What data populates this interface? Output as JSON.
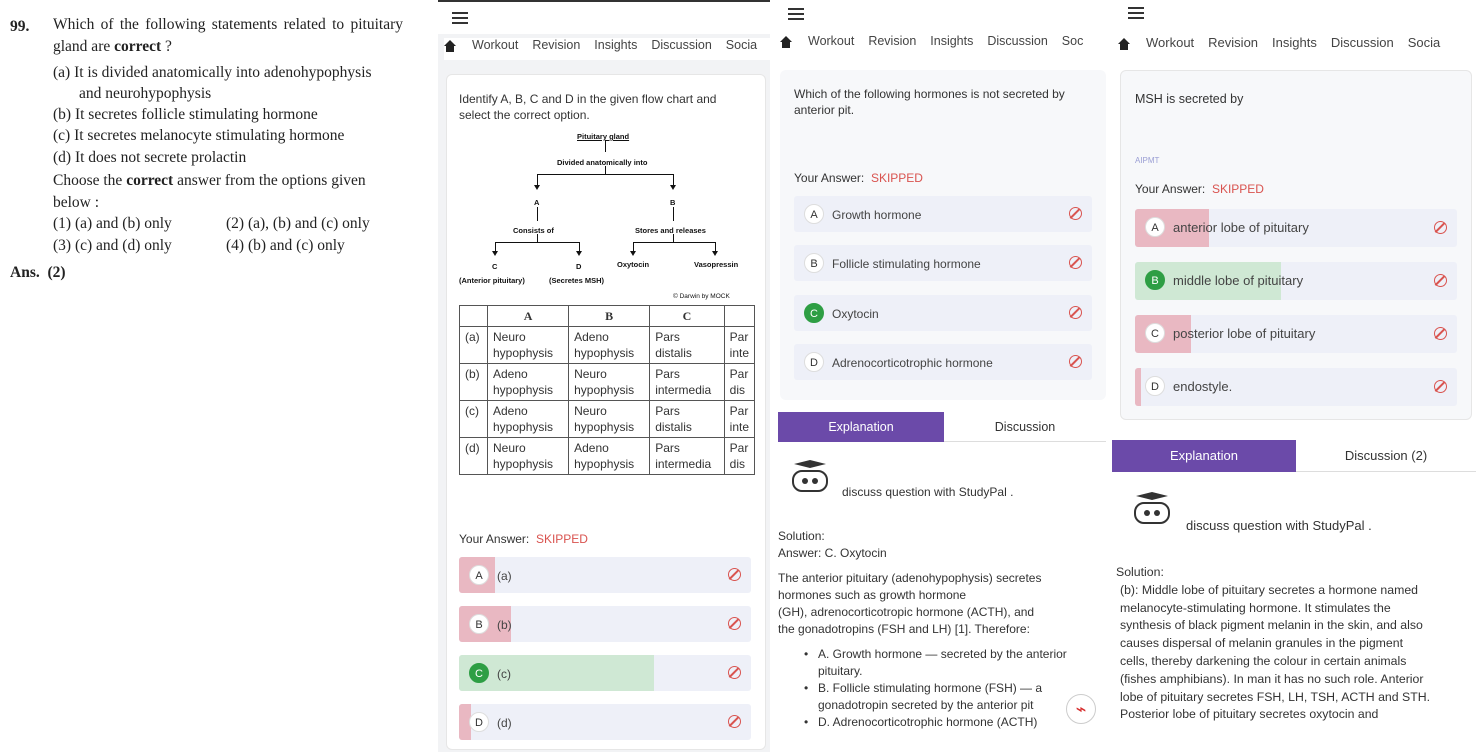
{
  "book": {
    "qnum": "99.",
    "question": "Which of the following statements related to pituitary gland are",
    "q_bold": "correct",
    "q_end": " ?",
    "statements": [
      "(a)  It is divided anatomically into adenohypophysis",
      "and neurohypophysis",
      "(b)  It secretes follicle stimulating hormone",
      "(c)  It secretes melanocyte stimulating hormone",
      "(d)  It does not secrete prolactin"
    ],
    "choose_pre": "Choose the ",
    "choose_bold": "correct",
    "choose_post": " answer from the options given",
    "below": "below :",
    "opt1": "(1)  (a) and (b) only",
    "opt2": "(2)  (a), (b) and (c) only",
    "opt3": "(3)  (c) and (d) only",
    "opt4": "(4)  (b) and (c) only",
    "ans_label": "Ans.",
    "ans_val": "(2)"
  },
  "tabs": [
    "Workout",
    "Revision",
    "Insights",
    "Discussion",
    "Socia"
  ],
  "tabs_short": [
    "Workout",
    "Revision",
    "Insights",
    "Discussion",
    "Soc"
  ],
  "p2": {
    "question": "Identify A, B, C and D in the given flow chart and select the correct option.",
    "flow": {
      "root": "Pituitary gland",
      "div": "Divided anatomically into",
      "a": "A",
      "b": "B",
      "consists": "Consists of",
      "stores": "Stores and releases",
      "c": "C",
      "d": "D",
      "oxy": "Oxytocin",
      "vaso": "Vasopressin",
      "ant": "(Anterior pituitary)",
      "msh": "(Secretes MSH)",
      "credit": "© Darwin by MOCK"
    },
    "table": {
      "headers": [
        "",
        "A",
        "B",
        "C",
        ""
      ],
      "rows": [
        [
          "(a)",
          "Neuro hypophysis",
          "Adeno hypophysis",
          "Pars distalis",
          "Par inte"
        ],
        [
          "(b)",
          "Adeno hypophysis",
          "Neuro hypophysis",
          "Pars intermedia",
          "Par dis"
        ],
        [
          "(c)",
          "Adeno hypophysis",
          "Neuro hypophysis",
          "Pars distalis",
          "Par inte"
        ],
        [
          "(d)",
          "Neuro hypophysis",
          "Adeno hypophysis",
          "Pars intermedia",
          "Par dis"
        ]
      ]
    },
    "your_answer": "Your Answer:",
    "skipped": "SKIPPED",
    "options": [
      {
        "letter": "A",
        "text": "(a)"
      },
      {
        "letter": "B",
        "text": "(b)"
      },
      {
        "letter": "C",
        "text": "(c)"
      },
      {
        "letter": "D",
        "text": "(d)"
      }
    ]
  },
  "p3": {
    "question": "Which of the following hormones is not secreted by anterior pit.",
    "your_answer": "Your Answer:",
    "skipped": "SKIPPED",
    "options": [
      {
        "letter": "A",
        "text": "Growth hormone"
      },
      {
        "letter": "B",
        "text": "Follicle stimulating hormone"
      },
      {
        "letter": "C",
        "text": "Oxytocin"
      },
      {
        "letter": "D",
        "text": "Adrenocorticotrophic hormone"
      }
    ],
    "tab_explanation": "Explanation",
    "tab_discussion": "Discussion",
    "studypal": "discuss question with StudyPal .",
    "solution": "Solution:",
    "answer": "Answer: C. Oxytocin",
    "sol_lines": [
      "The anterior pituitary (adenohypophysis) secretes",
      "hormones such as growth hormone",
      "(GH), adrenocorticotropic hormone (ACTH), and",
      "the gonadotropins (FSH and LH) [1]. Therefore:"
    ],
    "bullets": [
      "A. Growth hormone — secreted by the anterior",
      "pituitary.",
      "B. Follicle stimulating hormone (FSH) — a",
      "gonadotropin secreted by the anterior pit",
      "D. Adrenocorticotrophic hormone (ACTH)"
    ]
  },
  "p4": {
    "question": "MSH is secreted by",
    "tag": "AIPMT",
    "your_answer": "Your Answer:",
    "skipped": "SKIPPED",
    "options": [
      {
        "letter": "A",
        "text": "anterior lobe of pituitary"
      },
      {
        "letter": "B",
        "text": "middle lobe of pituitary"
      },
      {
        "letter": "C",
        "text": "posterior lobe of pituitary"
      },
      {
        "letter": "D",
        "text": "endostyle."
      }
    ],
    "tab_explanation": "Explanation",
    "tab_discussion": "Discussion (2)",
    "studypal": "discuss question with StudyPal .",
    "solution": "Solution:",
    "sol_lines": [
      "(b): Middle lobe of pituitary secretes a hormone named",
      "melanocyte-stimulating hormone. It stimulates the",
      "synthesis of black pigment melanin in the skin, and also",
      "causes dispersal of melanin granules in the pigment",
      "cells, thereby darkening the colour in certain animals",
      "(fishes amphibians). In man it has no such role. Anterior",
      "lobe of pituitary secretes FSH, LH, TSH, ACTH and STH.",
      "Posterior lobe of pituitary secretes oxytocin and"
    ]
  },
  "colors": {
    "accent": "#6b4aa9",
    "skipped": "#d9534f",
    "correct": "#2e9e44",
    "wrong_fill": "#e9b8c2",
    "right_fill": "#cfe8d4"
  }
}
